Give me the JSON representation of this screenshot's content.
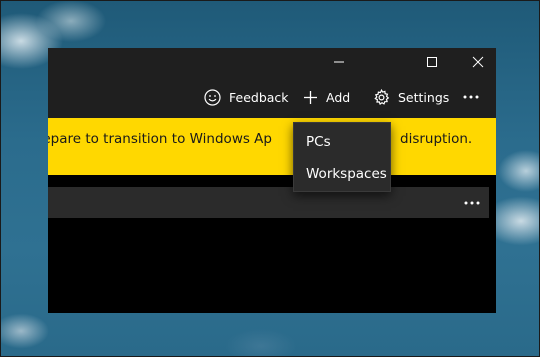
{
  "toolbar": {
    "feedback_label": "Feedback",
    "add_label": "Add",
    "settings_label": "Settings"
  },
  "banner": {
    "left_text": "uld prepare to transition to Windows Ap",
    "right_text": "disruption."
  },
  "add_menu": {
    "items": [
      {
        "label": "PCs"
      },
      {
        "label": "Workspaces"
      }
    ]
  },
  "colors": {
    "banner_bg": "#ffd800",
    "window_chrome": "#1f1f1f",
    "window_bg": "#000000",
    "menu_bg": "#2b2b2b",
    "text": "#ffffff"
  },
  "icons": {
    "feedback": "smiley-icon",
    "add": "plus-icon",
    "settings": "gear-icon",
    "more": "ellipsis-icon",
    "minimize": "minimize-icon",
    "maximize": "maximize-icon",
    "close": "close-icon"
  }
}
